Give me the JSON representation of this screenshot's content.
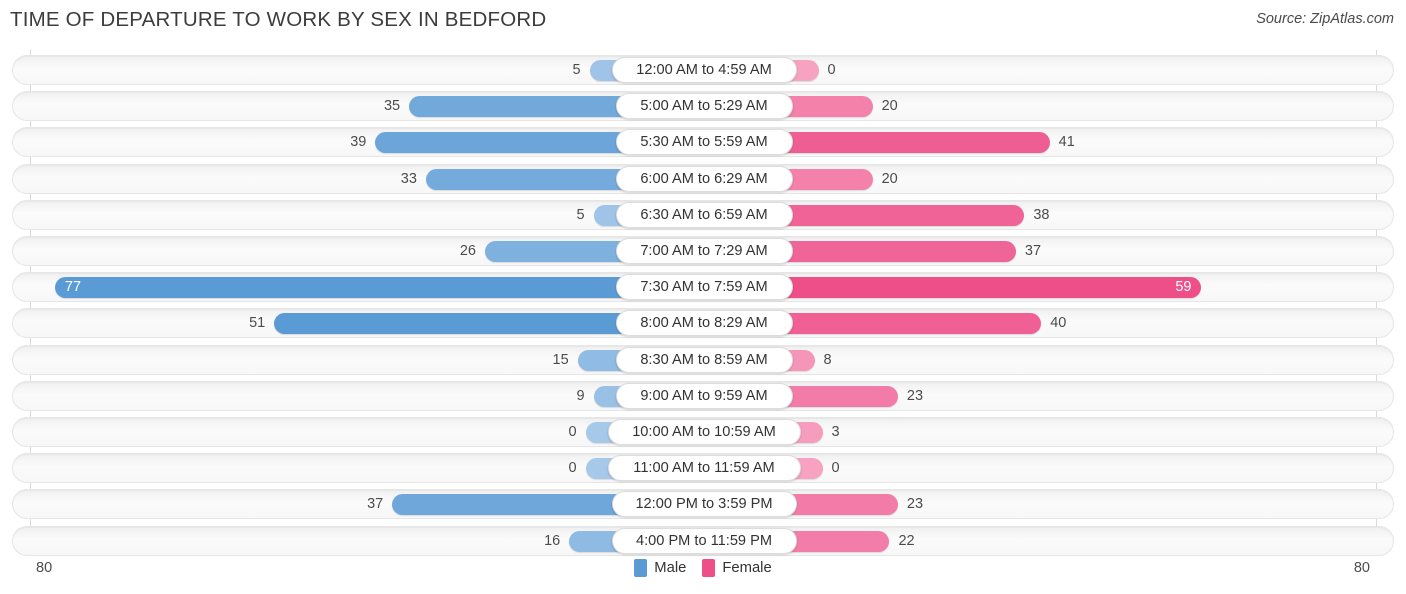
{
  "header": {
    "title": "TIME OF DEPARTURE TO WORK BY SEX IN BEDFORD",
    "source": "Source: ZipAtlas.com"
  },
  "legend": {
    "male_label": "Male",
    "female_label": "Female",
    "male_color": "#5b9bd5",
    "female_color": "#ee4f89"
  },
  "axis": {
    "left_max": "80",
    "right_max": "80",
    "max_value": 80
  },
  "chart_data": {
    "type": "bar",
    "orientation": "horizontal-diverging",
    "title": "TIME OF DEPARTURE TO WORK BY SEX IN BEDFORD",
    "xlabel": "",
    "ylabel": "",
    "xlim": [
      80,
      80
    ],
    "grid": false,
    "legend_position": "bottom-center",
    "categories": [
      "12:00 AM to 4:59 AM",
      "5:00 AM to 5:29 AM",
      "5:30 AM to 5:59 AM",
      "6:00 AM to 6:29 AM",
      "6:30 AM to 6:59 AM",
      "7:00 AM to 7:29 AM",
      "7:30 AM to 7:59 AM",
      "8:00 AM to 8:29 AM",
      "8:30 AM to 8:59 AM",
      "9:00 AM to 9:59 AM",
      "10:00 AM to 10:59 AM",
      "11:00 AM to 11:59 AM",
      "12:00 PM to 3:59 PM",
      "4:00 PM to 11:59 PM"
    ],
    "series": [
      {
        "name": "Male",
        "color": "#5b9bd5",
        "direction": "left",
        "values": [
          5,
          35,
          39,
          33,
          5,
          26,
          77,
          51,
          15,
          9,
          0,
          0,
          37,
          16
        ]
      },
      {
        "name": "Female",
        "color": "#ee4f89",
        "direction": "right",
        "values": [
          0,
          20,
          41,
          20,
          38,
          37,
          59,
          40,
          8,
          23,
          3,
          0,
          23,
          22
        ]
      }
    ]
  }
}
